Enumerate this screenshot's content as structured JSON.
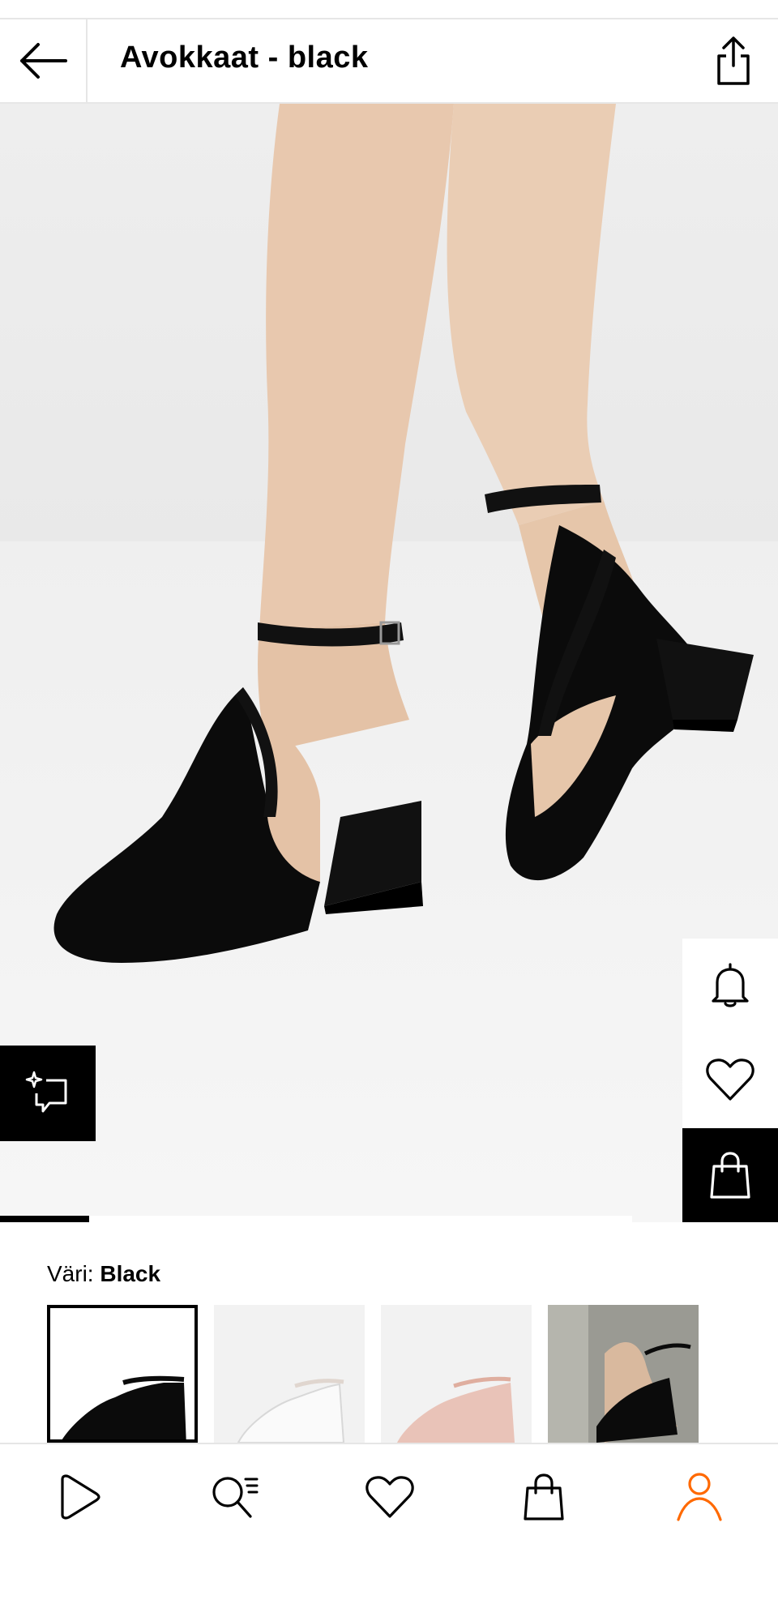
{
  "header": {
    "title": "Avokkaat - black",
    "back_icon": "arrow-left-icon",
    "share_icon": "share-icon"
  },
  "product": {
    "color_prefix": "Väri:",
    "color_value": "Black",
    "image_progress": 0.115,
    "swatches": [
      {
        "name": "black",
        "selected": true
      },
      {
        "name": "white",
        "selected": false
      },
      {
        "name": "pink",
        "selected": false
      },
      {
        "name": "black-lifestyle",
        "selected": false
      }
    ]
  },
  "actions": {
    "notify_icon": "bell-icon",
    "wishlist_icon": "heart-icon",
    "cart_icon": "shopping-bag-icon",
    "compare_icon": "sparkle-compare-icon"
  },
  "tabbar": {
    "items": [
      {
        "icon": "play-icon",
        "active": false
      },
      {
        "icon": "search-list-icon",
        "active": false
      },
      {
        "icon": "heart-icon",
        "active": false
      },
      {
        "icon": "bag-icon",
        "active": false
      },
      {
        "icon": "profile-icon",
        "active": true
      }
    ],
    "active_color": "#ff6900"
  }
}
